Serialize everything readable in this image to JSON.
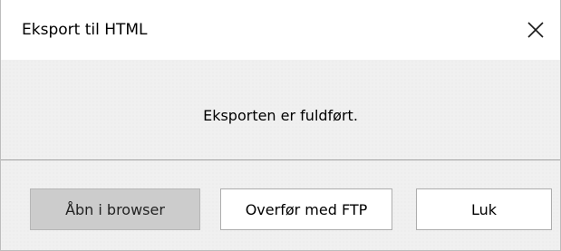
{
  "window": {
    "title": "Eksport til HTML",
    "close_icon": "close-icon"
  },
  "content": {
    "message": "Eksporten er fuldført."
  },
  "buttons": {
    "open_browser": "Åbn i browser",
    "ftp": "Overfør med FTP",
    "close": "Luk"
  },
  "colors": {
    "title_bar_bg": "#ffffff",
    "dialog_bg": "#f0f0f0",
    "separator": "#a0a0a0",
    "button_bg": "#ffffff",
    "pressed_button_bg": "#cccccc"
  }
}
